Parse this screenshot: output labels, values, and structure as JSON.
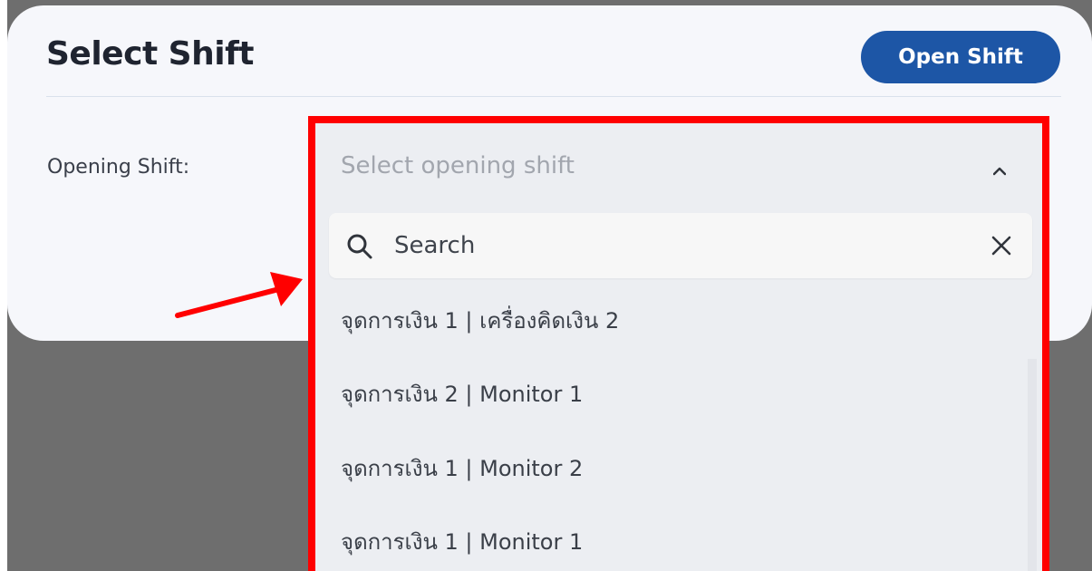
{
  "card": {
    "title": "Select Shift",
    "open_shift_label": "Open Shift"
  },
  "form": {
    "opening_shift_label": "Opening Shift:"
  },
  "dropdown": {
    "placeholder": "Select opening shift",
    "expanded": true,
    "search": {
      "placeholder": "Search",
      "value": ""
    },
    "options": [
      "จุดการเงิน 1 | เครื่องคิดเงิน 2",
      "จุดการเงิน 2 | Monitor 1",
      "จุดการเงิน 1 | Monitor 2",
      "จุดการเงิน 1 | Monitor 1"
    ]
  },
  "icons": {
    "chevron": "chevron-up-icon",
    "search": "search-icon",
    "clear": "close-icon",
    "annotation": "arrow-icon"
  },
  "colors": {
    "primary_button": "#1d56a6",
    "highlight_border": "#ff0000",
    "annotation_arrow": "#ff0000",
    "backdrop": "#6e6e6e",
    "card_background": "#f6f7fb",
    "dropdown_background": "#eceef2"
  }
}
